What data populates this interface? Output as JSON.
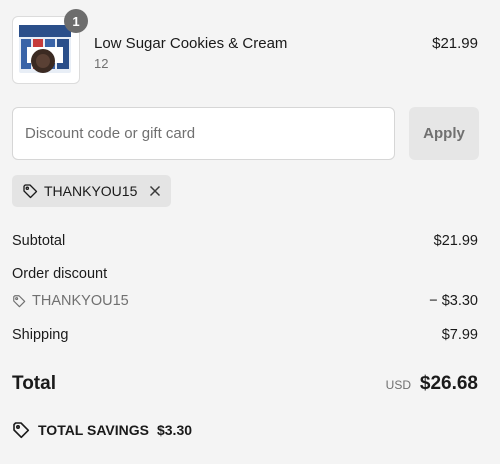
{
  "product": {
    "quantity_badge": "1",
    "name": "Low Sugar Cookies & Cream",
    "variant": "12",
    "price": "$21.99"
  },
  "discount": {
    "placeholder": "Discount code or gift card",
    "apply_label": "Apply",
    "applied_code": "THANKYOU15"
  },
  "summary": {
    "subtotal_label": "Subtotal",
    "subtotal_value": "$21.99",
    "order_discount_label": "Order discount",
    "discount_code": "THANKYOU15",
    "discount_value": "− $3.30",
    "shipping_label": "Shipping",
    "shipping_value": "$7.99",
    "total_label": "Total",
    "currency": "USD",
    "total_value": "$26.68",
    "savings_label": "TOTAL SAVINGS",
    "savings_value": "$3.30"
  },
  "colors": {
    "background": "#f4f4f4",
    "muted_text": "#707070",
    "chip_bg": "#e4e4e4"
  }
}
